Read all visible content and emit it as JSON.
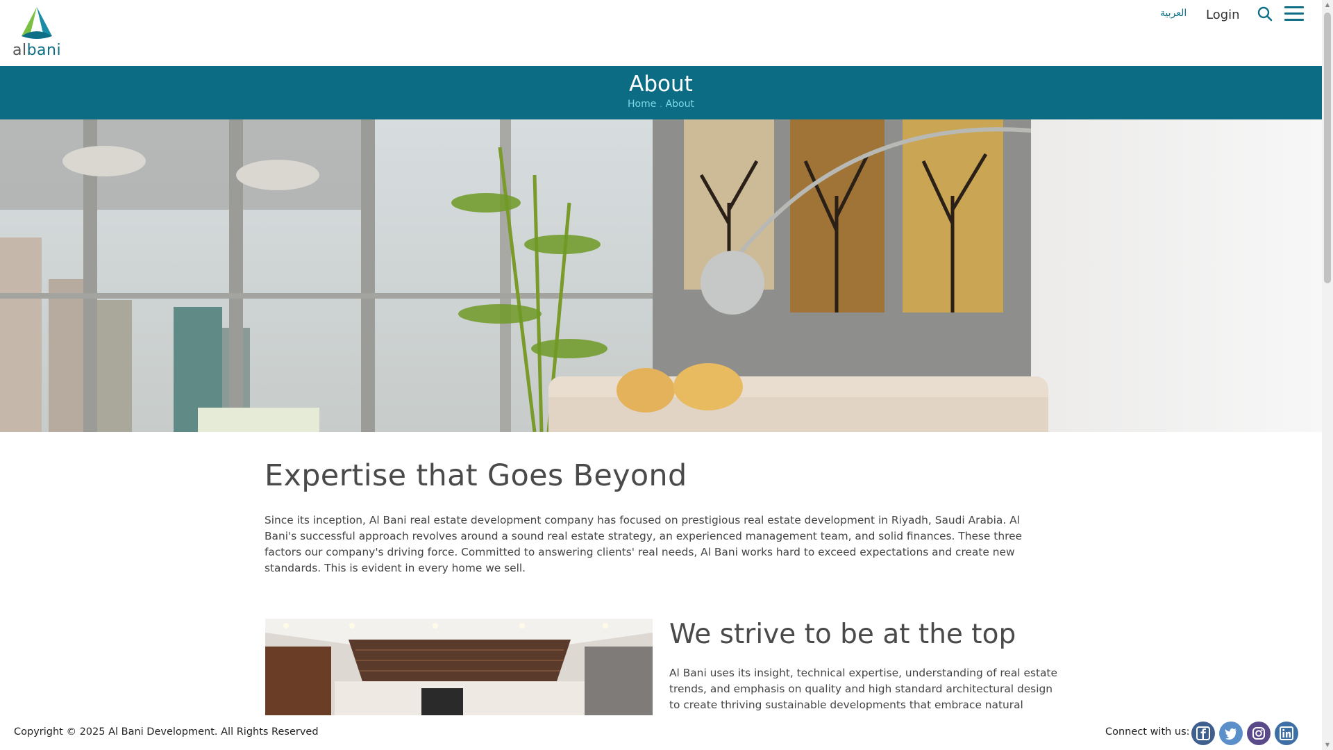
{
  "header": {
    "logo_text_prefix": "al",
    "logo_text_suffix": "bani",
    "lang_switch": "العربية",
    "login": "Login",
    "search_icon": "search-icon",
    "menu_icon": "hamburger-menu-icon"
  },
  "banner": {
    "title": "About",
    "breadcrumb": [
      "Home",
      "About"
    ],
    "breadcrumb_separator": "."
  },
  "hero": {
    "image": "living-room-interior-photo"
  },
  "main": {
    "heading": "Expertise that Goes Beyond",
    "intro": "Since its inception, Al Bani real estate development company has focused on prestigious real estate development in Riyadh, Saudi Arabia. Al Bani's successful approach revolves around a sound real estate strategy, an experienced management team, and solid finances. These three factors our company's driving force. Committed to answering clients' real needs, Al Bani works hard to exceed expectations and create new standards. This is evident in every home we sell.",
    "section2": {
      "heading": "We strive to be at the top",
      "text": "Al Bani uses its insight, technical expertise, understanding of real estate trends, and emphasis on quality and high standard architectural design to create thriving sustainable developments that embrace natural beauty"
    }
  },
  "footer": {
    "copyright": "Copyright © 2025 Al Bani Development. All Rights Reserved",
    "connect_label": "Connect with us:",
    "social": [
      "facebook-icon",
      "twitter-icon",
      "instagram-icon",
      "linkedin-icon"
    ]
  },
  "colors": {
    "brand_teal": "#0b6c84",
    "breadcrumb": "#7ed8e8",
    "logo_green": "#7ac143",
    "social_bg": "#3f5f8f"
  }
}
